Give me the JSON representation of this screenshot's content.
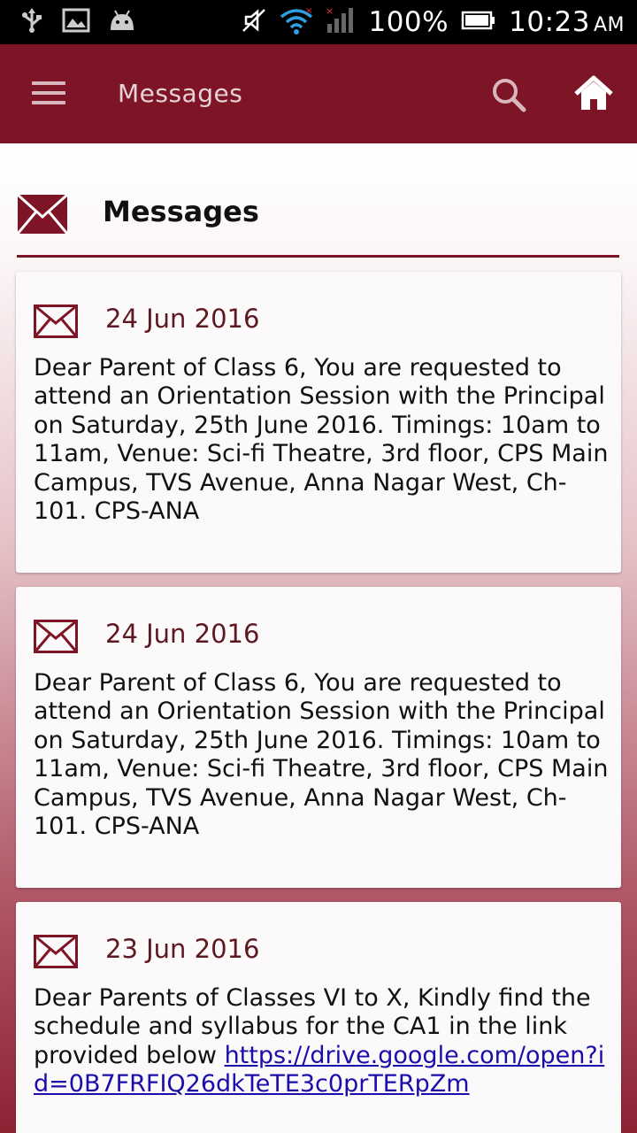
{
  "status_bar": {
    "battery_percent": "100%",
    "time": "10:23",
    "ampm": "AM",
    "icons": [
      "usb-icon",
      "image-icon",
      "android-icon",
      "mute-icon",
      "wifi-icon",
      "signal-icon",
      "battery-icon"
    ]
  },
  "app_bar": {
    "title": "Messages",
    "icons": [
      "menu-icon",
      "search-icon",
      "home-icon"
    ]
  },
  "section": {
    "title": "Messages",
    "icon": "envelope-icon"
  },
  "colors": {
    "primary": "#7d1526",
    "date_text": "#5e1822",
    "link": "#1a0dab"
  },
  "messages": [
    {
      "date": "24 Jun 2016",
      "body": "Dear Parent of Class 6, You are requested to attend an Orientation Session with the Principal on Saturday, 25th June 2016. Timings: 10am to 11am, Venue: Sci-fi Theatre, 3rd floor, CPS Main Campus, TVS Avenue, Anna Nagar West, Ch-101. CPS-ANA"
    },
    {
      "date": "24 Jun 2016",
      "body": "Dear Parent of Class 6, You are requested to attend an Orientation Session with the Principal on Saturday, 25th June 2016. Timings: 10am to 11am, Venue: Sci-fi Theatre, 3rd floor, CPS Main Campus, TVS Avenue, Anna Nagar West, Ch-101. CPS-ANA"
    },
    {
      "date": "23 Jun 2016",
      "body": "Dear Parents of Classes VI to X, Kindly find the schedule and syllabus for the CA1 in the link provided below ",
      "link": "https://drive.google.com/open?id=0B7FRFIQ26dkTeTE3c0prTERpZm"
    }
  ]
}
